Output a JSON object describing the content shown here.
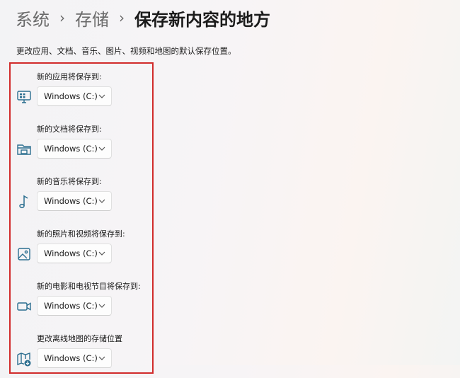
{
  "breadcrumb": {
    "items": [
      "系统",
      "存储"
    ],
    "current": "保存新内容的地方",
    "separator": "›"
  },
  "description": "更改应用、文档、音乐、图片、视频和地图的默认保存位置。",
  "colors": {
    "accent_icon": "#2b6e8f",
    "highlight_border": "#d12b2b"
  },
  "settings": [
    {
      "label": "新的应用将保存到:",
      "value": "Windows (C:)",
      "icon": "monitor-apps-icon"
    },
    {
      "label": "新的文档将保存到:",
      "value": "Windows (C:)",
      "icon": "folder-icon"
    },
    {
      "label": "新的音乐将保存到:",
      "value": "Windows (C:)",
      "icon": "music-note-icon"
    },
    {
      "label": "新的照片和视频将保存到:",
      "value": "Windows (C:)",
      "icon": "photo-icon"
    },
    {
      "label": "新的电影和电视节目将保存到:",
      "value": "Windows (C:)",
      "icon": "video-camera-icon"
    },
    {
      "label": "更改离线地图的存储位置",
      "value": "Windows (C:)",
      "icon": "map-download-icon"
    }
  ]
}
